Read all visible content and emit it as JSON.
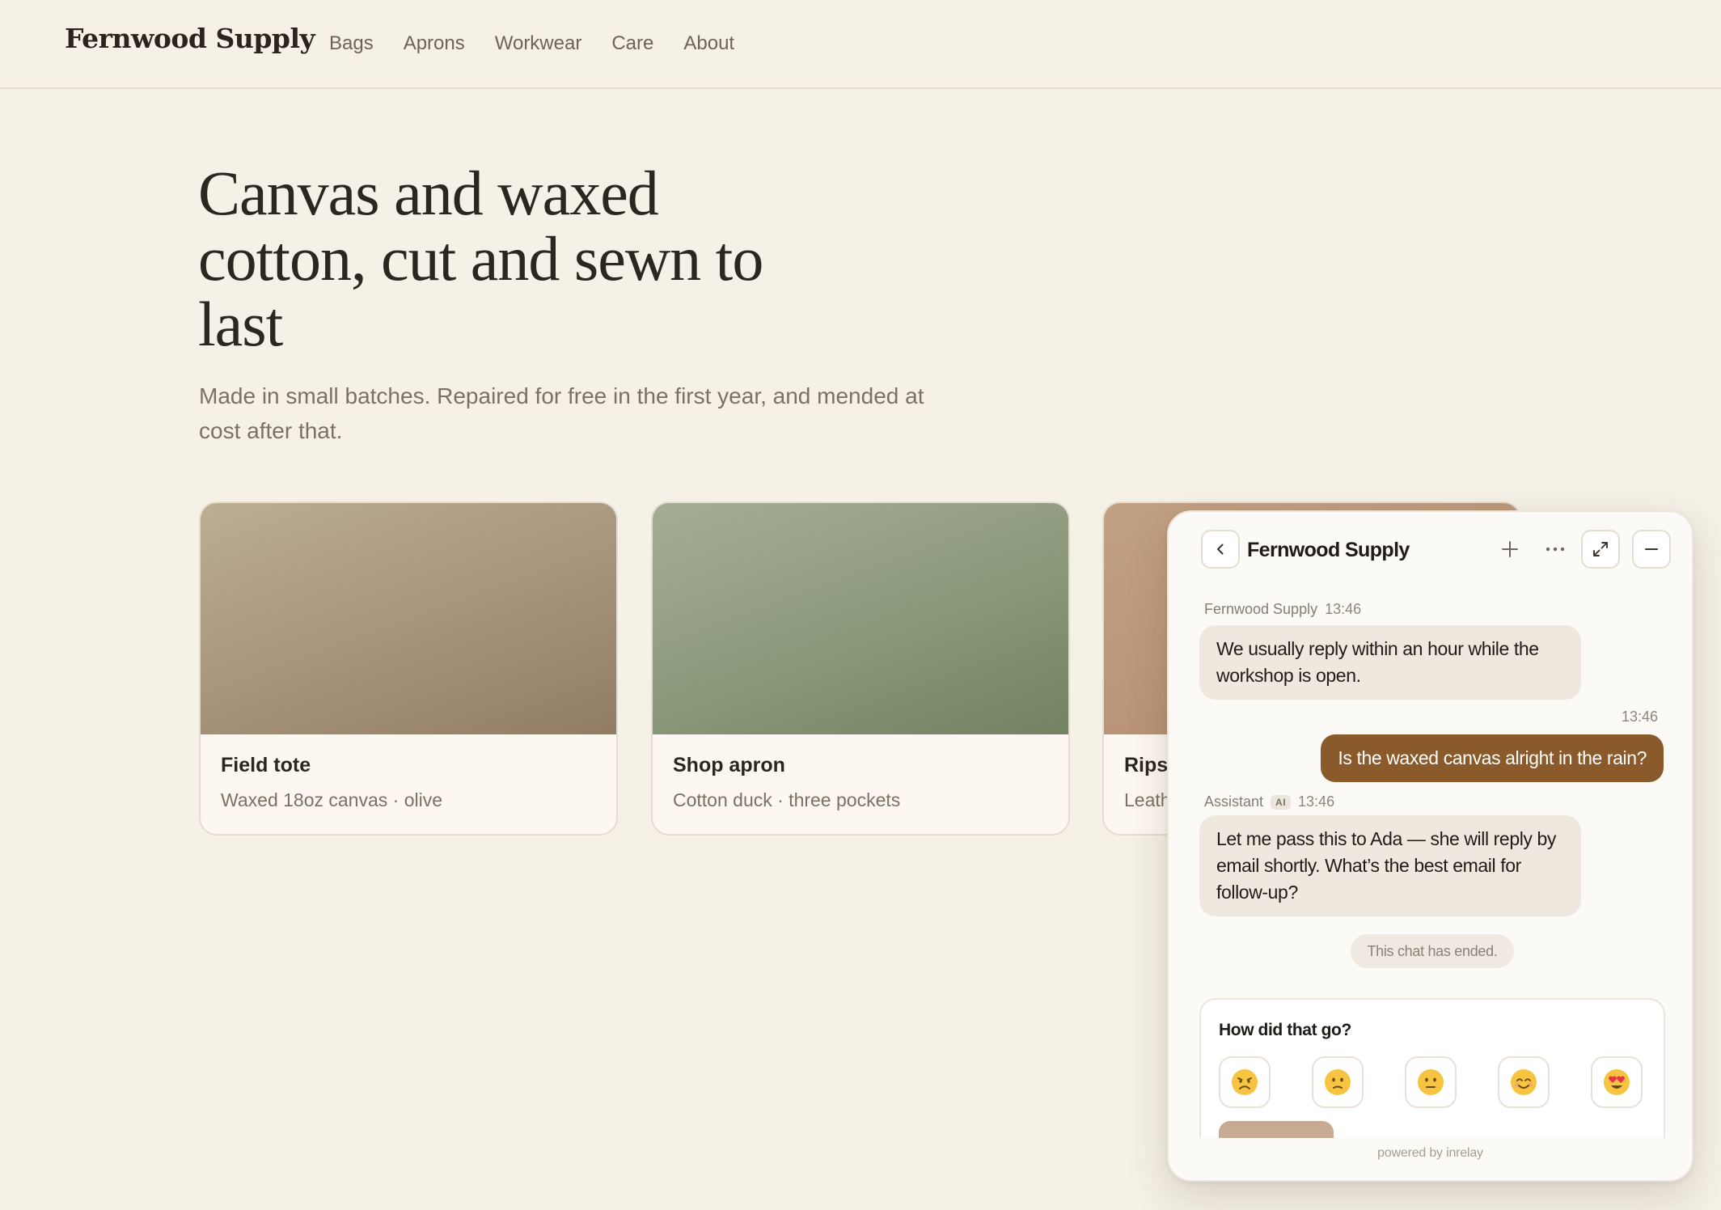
{
  "header": {
    "logo": "Fernwood Supply",
    "nav": [
      "Bags",
      "Aprons",
      "Workwear",
      "Care",
      "About"
    ]
  },
  "hero": {
    "title": "Canvas and waxed cotton, cut and sewn to last",
    "subtitle": "Made in small batches. Repaired for free in the first year, and mended at cost after that."
  },
  "products": [
    {
      "name": "Field tote",
      "desc": "Waxed 18oz canvas · olive"
    },
    {
      "name": "Shop apron",
      "desc": "Cotton duck · three pockets"
    },
    {
      "name": "Rips",
      "desc": "Leath"
    }
  ],
  "chat": {
    "title": "Fernwood Supply",
    "messages": [
      {
        "sender": "Fernwood Supply",
        "time": "13:46",
        "text": "We usually reply within an hour while the workshop is open."
      },
      {
        "time": "13:46",
        "text": "Is the waxed canvas alright in the rain?"
      },
      {
        "sender": "Assistant",
        "tag": "AI",
        "time": "13:46",
        "text": "Let me pass this to Ada — she will reply by email shortly. What’s the best email for follow-up?"
      }
    ],
    "ended_notice": "This chat has ended.",
    "feedback_question": "How did that go?",
    "feedback_options": [
      "very-sad-emoji",
      "slightly-sad-emoji",
      "neutral-emoji",
      "smiling-emoji",
      "heart-eyes-emoji"
    ],
    "powered_by": "powered by inrelay"
  },
  "colors": {
    "background": "#f5f1e7",
    "accent": "#8a5a2b",
    "agent_bubble": "#efe8df"
  }
}
